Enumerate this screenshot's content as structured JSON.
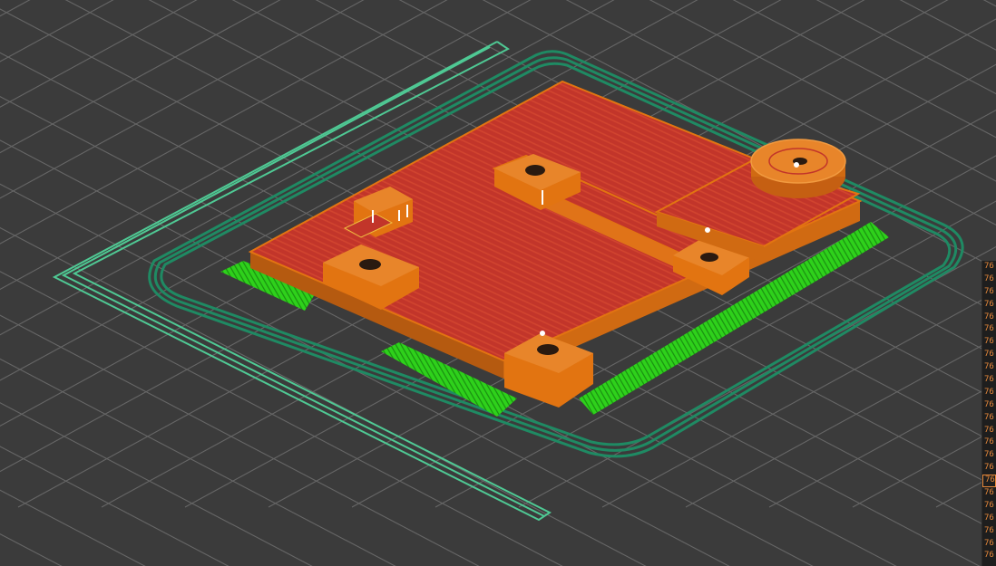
{
  "app": {
    "view": "sliced-preview-3d"
  },
  "colors": {
    "background": "#3b3b3b",
    "grid": "#8a8a8a",
    "skirt": "#1f8a63",
    "wipe_lines": "#4fc994",
    "support": "#2ed11b",
    "top_solid_infill": "#c2352a",
    "perimeter": "#e27411",
    "travel_marker": "#ffffff"
  },
  "layer_slider": {
    "ticks": [
      "76",
      "76",
      "76",
      "76",
      "76",
      "76",
      "76",
      "76",
      "76",
      "76",
      "76",
      "76",
      "76",
      "76",
      "76",
      "76",
      "76",
      "76",
      "76",
      "76",
      "76",
      "76",
      "76",
      "76"
    ],
    "selected_index": 17
  }
}
